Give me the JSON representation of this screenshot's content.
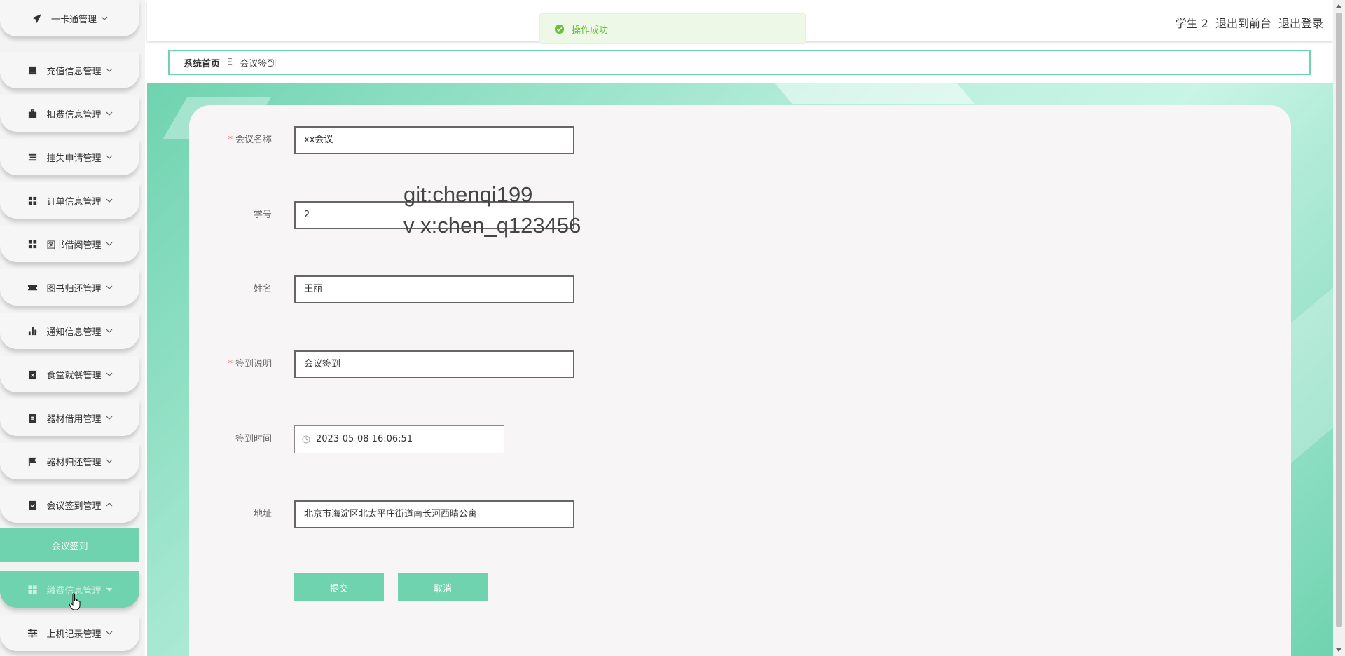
{
  "sidebar": {
    "items": [
      {
        "label": "一卡通管理",
        "icon": "send-icon",
        "expanded": false
      },
      {
        "label": "充值信息管理",
        "icon": "receipt-icon",
        "expanded": false
      },
      {
        "label": "扣费信息管理",
        "icon": "briefcase-icon",
        "expanded": false
      },
      {
        "label": "挂失申请管理",
        "icon": "list-icon",
        "expanded": false
      },
      {
        "label": "订单信息管理",
        "icon": "grid-icon",
        "expanded": false
      },
      {
        "label": "图书借阅管理",
        "icon": "grid-icon",
        "expanded": false
      },
      {
        "label": "图书归还管理",
        "icon": "ticket-icon",
        "expanded": false
      },
      {
        "label": "通知信息管理",
        "icon": "bar-chart-icon",
        "expanded": false
      },
      {
        "label": "食堂就餐管理",
        "icon": "clipboard-x-icon",
        "expanded": false
      },
      {
        "label": "器材借用管理",
        "icon": "clipboard-icon",
        "expanded": false
      },
      {
        "label": "器材归还管理",
        "icon": "flag-icon",
        "expanded": false
      },
      {
        "label": "会议签到管理",
        "icon": "clipboard-check-icon",
        "expanded": true
      },
      {
        "label": "缴费信息管理",
        "icon": "grid-icon",
        "expanded": false
      },
      {
        "label": "上机记录管理",
        "icon": "sliders-icon",
        "expanded": false
      }
    ],
    "submenu": {
      "label": "会议签到"
    }
  },
  "topbar": {
    "user": "学生 2",
    "to_front": "退出到前台",
    "logout": "退出登录"
  },
  "toast": {
    "message": "操作成功",
    "type": "success",
    "color": "#67c23a"
  },
  "breadcrumb": {
    "home": "系统首页",
    "separator": "Ξ",
    "current": "会议签到"
  },
  "form": {
    "meeting_name": {
      "label": "会议名称",
      "value": "xx会议",
      "required": true
    },
    "student_id": {
      "label": "学号",
      "value": "2",
      "required": false
    },
    "name": {
      "label": "姓名",
      "value": "王丽",
      "required": false
    },
    "description": {
      "label": "签到说明",
      "value": "会议签到",
      "required": true
    },
    "sign_time": {
      "label": "签到时间",
      "value": "2023-05-08 16:06:51",
      "required": false
    },
    "address": {
      "label": "地址",
      "value": "北京市海淀区北太平庄街道南长河西晴公寓",
      "required": false
    },
    "submit_label": "提交",
    "cancel_label": "取消",
    "required_mark": "*"
  },
  "watermark": {
    "line1": "git:chenqi199",
    "line2": "v x:chen_q123456"
  },
  "colors": {
    "accent": "#6fd3b0",
    "required": "#f56c6c",
    "success": "#67c23a"
  }
}
